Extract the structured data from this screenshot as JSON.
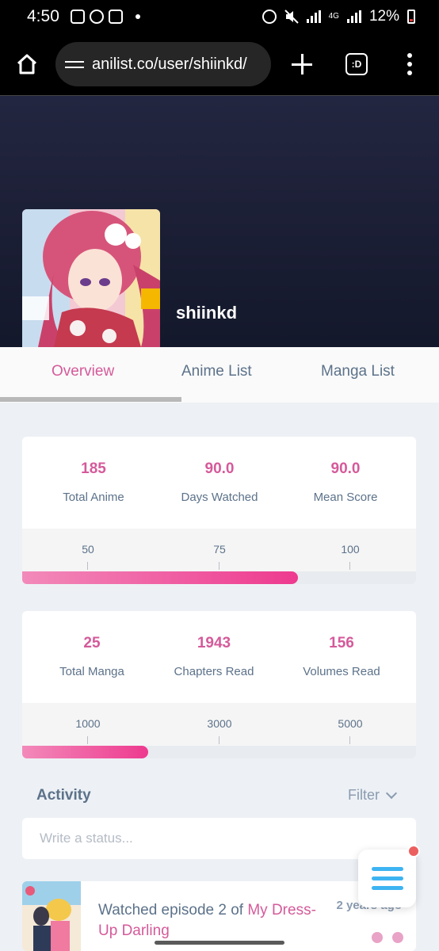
{
  "status_bar": {
    "time": "4:50",
    "network": "4G",
    "battery": "12%"
  },
  "browser": {
    "url": "anilist.co/user/shiinkd/",
    "tabs_badge": ":D"
  },
  "profile": {
    "username": "shiinkd"
  },
  "tabs": [
    {
      "label": "Overview",
      "active": true
    },
    {
      "label": "Anime List"
    },
    {
      "label": "Manga List"
    }
  ],
  "anime_stats": {
    "stats": [
      {
        "value": "185",
        "label": "Total Anime"
      },
      {
        "value": "90.0",
        "label": "Days Watched"
      },
      {
        "value": "90.0",
        "label": "Mean Score"
      }
    ],
    "ticks": [
      "50",
      "75",
      "100"
    ],
    "progress": 0.7
  },
  "manga_stats": {
    "stats": [
      {
        "value": "25",
        "label": "Total Manga"
      },
      {
        "value": "1943",
        "label": "Chapters Read"
      },
      {
        "value": "156",
        "label": "Volumes Read"
      }
    ],
    "ticks": [
      "1000",
      "3000",
      "5000"
    ],
    "progress": 0.32
  },
  "activity": {
    "title": "Activity",
    "filter_label": "Filter",
    "status_placeholder": "Write a status...",
    "entry": {
      "text": "Watched episode 2 of ",
      "media": "My Dress-Up Darling",
      "time": "2 years ago"
    }
  },
  "colors": {
    "accent": "#d55a9a",
    "text": "#5c728a",
    "fab": "#3db4f2"
  }
}
